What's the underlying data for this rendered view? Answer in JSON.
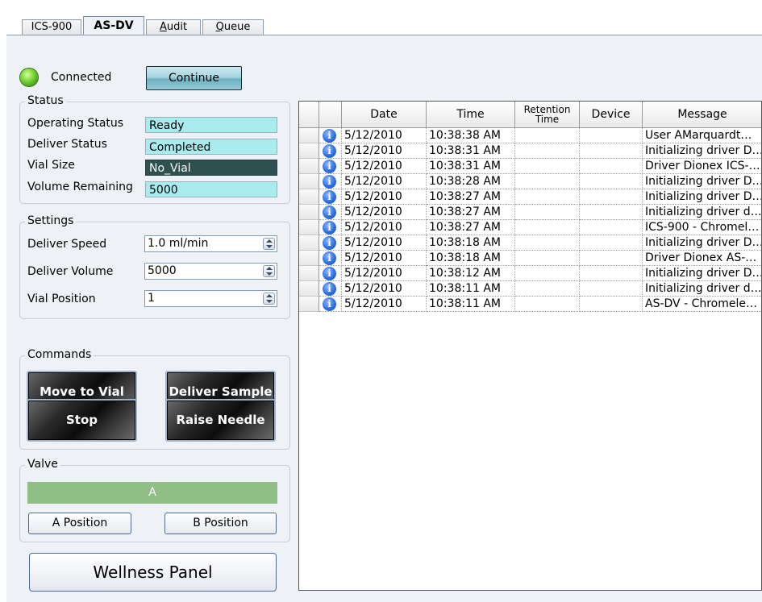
{
  "tabs": [
    {
      "label": "ICS-900",
      "active": false
    },
    {
      "label": "AS-DV",
      "active": true
    },
    {
      "label": "Audit",
      "active": false,
      "underline": "A",
      "rest": "udit"
    },
    {
      "label": "Queue",
      "active": false,
      "underline": "Q",
      "rest": "ueue"
    }
  ],
  "connection": {
    "label": "Connected",
    "led_color": "#5cc62a",
    "continue_label": "Continue"
  },
  "status": {
    "title": "Status",
    "fields": [
      {
        "label": "Operating Status",
        "value": "Ready"
      },
      {
        "label": "Deliver Status",
        "value": "Completed"
      },
      {
        "label": "Vial Size",
        "value": "No_Vial"
      },
      {
        "label": "Volume Remaining",
        "value": "5000"
      }
    ]
  },
  "settings": {
    "title": "Settings",
    "fields": [
      {
        "label": "Deliver Speed",
        "value": "1.0 ml/min"
      },
      {
        "label": "Deliver Volume",
        "value": "5000"
      },
      {
        "label": "Vial Position",
        "value": "1"
      }
    ]
  },
  "commands": {
    "title": "Commands",
    "buttons": [
      "Move to Vial",
      "Deliver Sample",
      "Stop",
      "Raise Needle"
    ]
  },
  "valve": {
    "title": "Valve",
    "current": "A",
    "buttons": [
      "A Position",
      "B Position"
    ]
  },
  "wellness_label": "Wellness Panel",
  "audit": {
    "columns": [
      "Date",
      "Time",
      "Retention Time",
      "Device",
      "Message"
    ],
    "rows": [
      {
        "date": "5/12/2010",
        "time": "10:38:38 AM",
        "retention": "",
        "device": "",
        "message": "User AMarquardt…"
      },
      {
        "date": "5/12/2010",
        "time": "10:38:31 AM",
        "retention": "",
        "device": "",
        "message": "Initializing driver D…"
      },
      {
        "date": "5/12/2010",
        "time": "10:38:31 AM",
        "retention": "",
        "device": "",
        "message": "Driver Dionex ICS-…"
      },
      {
        "date": "5/12/2010",
        "time": "10:38:28 AM",
        "retention": "",
        "device": "",
        "message": "Initializing driver D…"
      },
      {
        "date": "5/12/2010",
        "time": "10:38:27 AM",
        "retention": "",
        "device": "",
        "message": "Initializing driver D…"
      },
      {
        "date": "5/12/2010",
        "time": "10:38:27 AM",
        "retention": "",
        "device": "",
        "message": "Initializing driver d…"
      },
      {
        "date": "5/12/2010",
        "time": "10:38:27 AM",
        "retention": "",
        "device": "",
        "message": "ICS-900 - Chromel…"
      },
      {
        "date": "5/12/2010",
        "time": "10:38:18 AM",
        "retention": "",
        "device": "",
        "message": "Initializing driver D…"
      },
      {
        "date": "5/12/2010",
        "time": "10:38:18 AM",
        "retention": "",
        "device": "",
        "message": "Driver Dionex AS-…"
      },
      {
        "date": "5/12/2010",
        "time": "10:38:12 AM",
        "retention": "",
        "device": "",
        "message": "Initializing driver D…"
      },
      {
        "date": "5/12/2010",
        "time": "10:38:11 AM",
        "retention": "",
        "device": "",
        "message": "Initializing driver d…"
      },
      {
        "date": "5/12/2010",
        "time": "10:38:11 AM",
        "retention": "",
        "device": "",
        "message": "AS-DV - Chromele…"
      }
    ],
    "row_icon": "info-icon"
  }
}
